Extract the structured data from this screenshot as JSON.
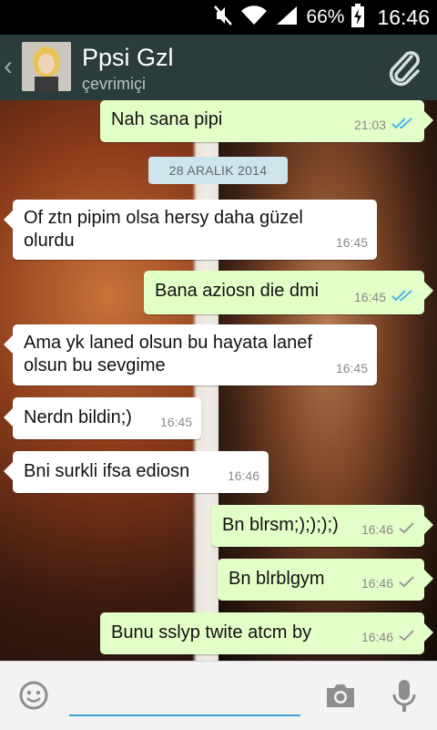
{
  "status_bar": {
    "battery": "66%",
    "time": "16:46"
  },
  "header": {
    "name": "Ppsi Gzl",
    "status": "çevrimiçi"
  },
  "date_separator": "28 ARALIK 2014",
  "messages": [
    {
      "text": "Nah sana pipi",
      "time": "21:03",
      "dir": "out",
      "ticks": "read"
    },
    {
      "text": "Of ztn pipim olsa hersy daha güzel olurdu",
      "time": "16:45",
      "dir": "in"
    },
    {
      "text": "Bana aziosn die dmi",
      "time": "16:45",
      "dir": "out",
      "ticks": "read"
    },
    {
      "text": "Ama yk laned olsun bu hayata lanef olsun bu sevgime",
      "time": "16:45",
      "dir": "in"
    },
    {
      "text": "Nerdn bildin;)",
      "time": "16:45",
      "dir": "in"
    },
    {
      "text": "Bni surkli ifsa ediosn",
      "time": "16:46",
      "dir": "in"
    },
    {
      "text": "Bn blrsm;);););)",
      "time": "16:46",
      "dir": "out",
      "ticks": "sent"
    },
    {
      "text": "Bn blrblgym",
      "time": "16:46",
      "dir": "out",
      "ticks": "sent"
    },
    {
      "text": "Bunu sslyp twite atcm by",
      "time": "16:46",
      "dir": "out",
      "ticks": "sent"
    }
  ],
  "input": {
    "value": "",
    "placeholder": ""
  },
  "icons": {
    "back": "chevron-left-icon",
    "attach": "paperclip-icon",
    "emoji": "smiley-icon",
    "camera": "camera-icon",
    "mic": "microphone-icon",
    "mute": "mute-icon",
    "wifi": "wifi-icon",
    "signal": "signal-icon",
    "battery": "battery-icon"
  },
  "colors": {
    "header": "#2b3c3c",
    "out_bubble": "#e2ffc7",
    "in_bubble": "#ffffff",
    "read_tick": "#4fb6ec",
    "input_underline": "#3aa3d8"
  }
}
